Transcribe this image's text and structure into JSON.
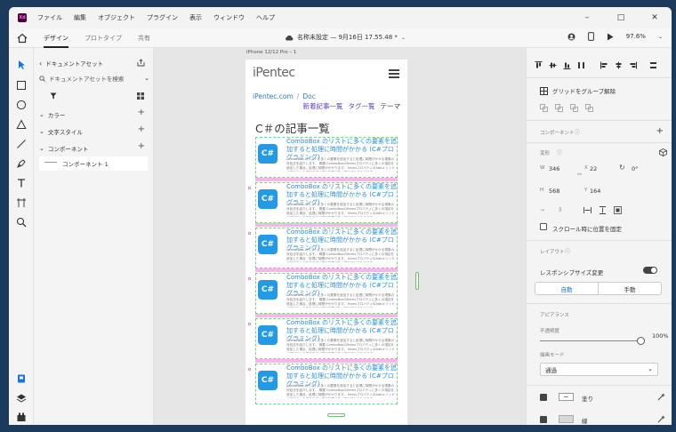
{
  "menubar": {
    "logo": "Xd",
    "items": [
      "ファイル",
      "編集",
      "オブジェクト",
      "プラグイン",
      "表示",
      "ウィンドウ",
      "ヘルプ"
    ]
  },
  "toolbar": {
    "tabs": [
      "デザイン",
      "プロトタイプ",
      "共有"
    ],
    "doc_title": "名称未設定 — 9月16日 17.55.48 *",
    "zoom": "97.6%"
  },
  "assets": {
    "header": "ドキュメントアセット",
    "search_placeholder": "ドキュメントアセットを検索",
    "sections": [
      "カラー",
      "文字スタイル",
      "コンポーネント"
    ],
    "component_item": "コンポーネント 1"
  },
  "canvas": {
    "artboard_label": "iPhone 12/12 Pro – 1",
    "logo": "iPentec",
    "breadcrumb": [
      "iPentec.com",
      "Doc"
    ],
    "breadcrumb_sep": "/",
    "nav": [
      "新着記事一覧",
      "タグ一覧",
      "テーマ"
    ],
    "heading": "C＃の記事一覧",
    "card_icon": "C#",
    "cards": [
      {
        "title": "ComboBox のリストに多くの要素を追加すると処理に時間がかかる (C#プログラミング)",
        "desc": "ComboBox のリストに多くの要素を追加すると処理に時間がかかる現象の対処法を紹介します。 概要 ComboBoxのItemsプロパティに多くの項目を追加した場合、処理に時間がかかります。 ItemsプロパティのAddメソッドの呼び出しを繰り返すと描画処理が多く実行されるためです。"
      },
      {
        "title": "ComboBox のリストに多くの要素を追加すると処理に時間がかかる (C#プログラミング)",
        "desc": "ComboBox のリストに多くの要素を追加すると処理に時間がかかる現象の対処法を紹介します。 概要 ComboBoxのItemsプロパティに多くの項目を追加した場合、処理に時間がかかります。 ItemsプロパティのAddメソッドの呼び出しを繰り返すと描画処理が多く実行されるためです。"
      },
      {
        "title": "ComboBox のリストに多くの要素を追加すると処理に時間がかかる (C#プログラミング)",
        "desc": "ComboBox のリストに多くの要素を追加すると処理に時間がかかる現象の対処法を紹介します。 概要 ComboBoxのItemsプロパティに多くの項目を追加した場合、処理に時間がかかります。 ItemsプロパティのAddメソッドの呼び出しを繰り返すと描画処理が多く実行されるためです。"
      },
      {
        "title": "ComboBox のリストに多くの要素を追加すると処理に時間がかかる (C#プログラミング)",
        "desc": "ComboBox のリストに多くの要素を追加すると処理に時間がかかる現象の対処法を紹介します。 概要 ComboBoxのItemsプロパティに多くの項目を追加した場合、処理に時間がかかります。 ItemsプロパティのAddメソッドの呼び出しを繰り返すと描画処理が多く実行されるためです。"
      },
      {
        "title": "ComboBox のリストに多くの要素を追加すると処理に時間がかかる (C#プログラミング)",
        "desc": "ComboBox のリストに多くの要素を追加すると処理に時間がかかる現象の対処法を紹介します。 概要 ComboBoxのItemsプロパティに多くの項目を追加した場合、処理に時間がかかります。 ItemsプロパティのAddメソッドの呼び出しを繰り返すと描画処理が多く実行されるためです。"
      },
      {
        "title": "ComboBox のリストに多くの要素を追加すると処理に時間がかかる (C#プログラミング)",
        "desc": "ComboBox のリストに多くの要素を追加すると処理に時間がかかる現象の対処法を紹介します。 概要 ComboBoxのItemsプロパティに多くの項目を追加した場合、処理に時間がかかります。 ItemsプロパティのAddメソッドの呼び出しを繰り返すと描画処理が多く実行されるためです。"
      }
    ]
  },
  "props": {
    "ungroup_grid": "グリッドをグループ解除",
    "component_label": "コンポーネント",
    "transform_label": "変形",
    "w_label": "W",
    "w_value": "346",
    "x_label": "X",
    "x_value": "22",
    "rotation_value": "0°",
    "h_label": "H",
    "h_value": "568",
    "y_label": "Y",
    "y_value": "164",
    "fix_on_scroll": "スクロール時に位置を固定",
    "layout_label": "レイアウト",
    "responsive_resize": "レスポンシブサイズ変更",
    "seg_auto": "自動",
    "seg_manual": "手動",
    "appearance_label": "アピアランス",
    "opacity_label": "不透明度",
    "opacity_value": "100%",
    "blend_label": "描画モード",
    "blend_value": "通過",
    "fill_label": "塗り",
    "border_label": "線"
  },
  "colors": {
    "accent": "#1473e6",
    "csharp_icon": "#239ae6",
    "card_title": "#2a8fd8",
    "stripe": "#f5b7e6",
    "nav_link": "#5b3fc4"
  }
}
